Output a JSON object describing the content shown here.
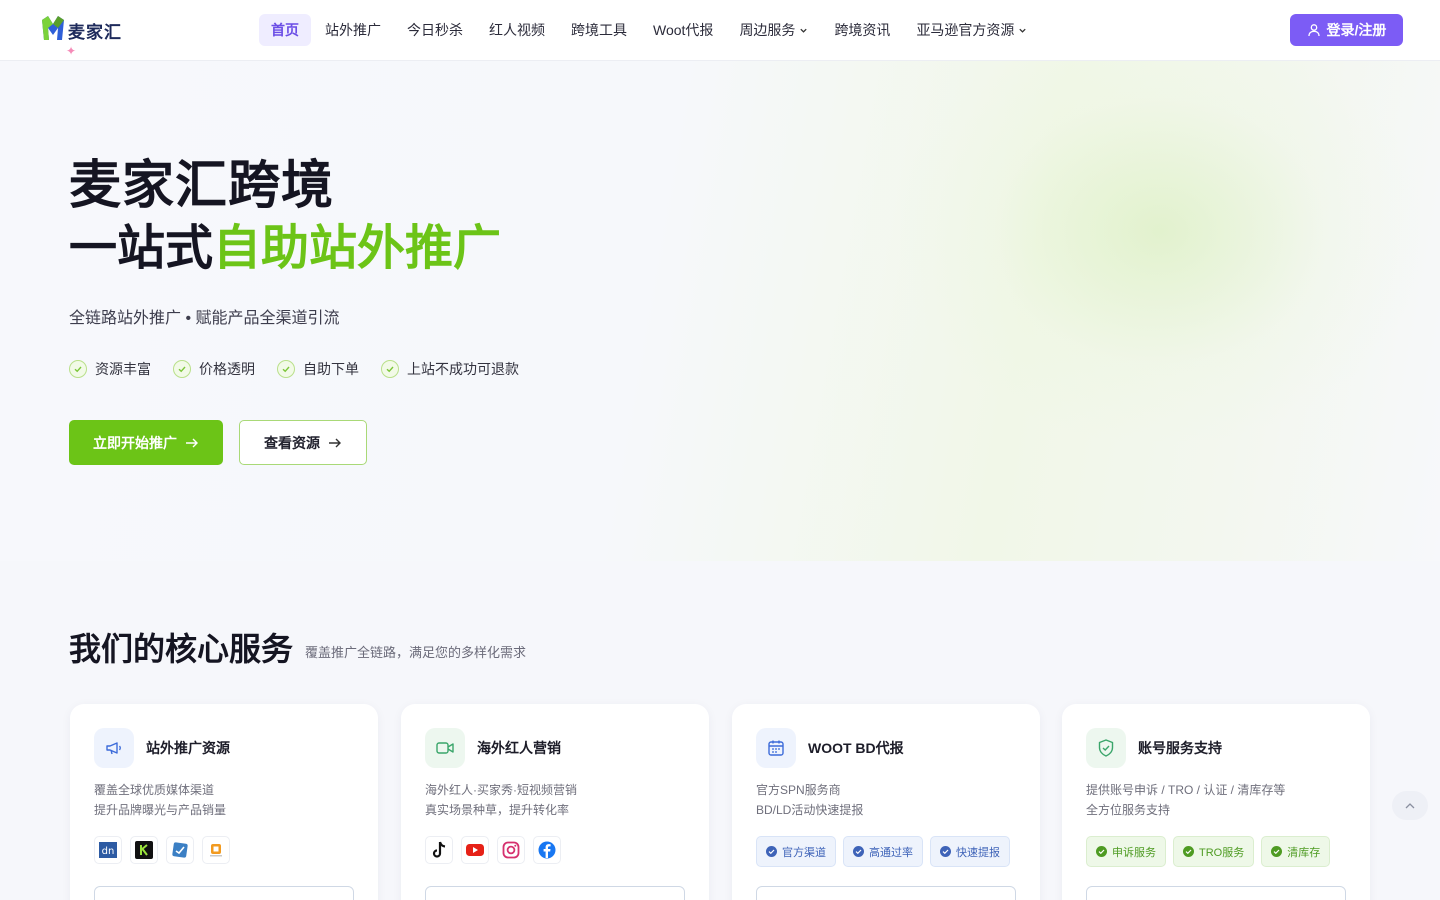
{
  "brand": {
    "name": "麦家汇"
  },
  "nav": {
    "items": [
      {
        "label": "首页",
        "active": true,
        "dropdown": false
      },
      {
        "label": "站外推广",
        "dropdown": false
      },
      {
        "label": "今日秒杀",
        "dropdown": false
      },
      {
        "label": "红人视频",
        "dropdown": false
      },
      {
        "label": "跨境工具",
        "dropdown": false
      },
      {
        "label": "Woot代报",
        "dropdown": false
      },
      {
        "label": "周边服务",
        "dropdown": true
      },
      {
        "label": "跨境资讯",
        "dropdown": false
      },
      {
        "label": "亚马逊官方资源",
        "dropdown": true
      }
    ],
    "login_label": "登录/注册"
  },
  "hero": {
    "title_line1": "麦家汇跨境",
    "title_line2_plain": "一站式",
    "title_line2_highlight": "自助站外推广",
    "subtitle": "全链路站外推广 • 赋能产品全渠道引流",
    "features": [
      "资源丰富",
      "价格透明",
      "自助下单",
      "上站不成功可退款"
    ],
    "primary_cta": "立即开始推广",
    "secondary_cta": "查看资源"
  },
  "services": {
    "title": "我们的核心服务",
    "subtitle": "覆盖推广全链路，满足您的多样化需求",
    "cards": [
      {
        "title": "站外推广资源",
        "icon": "megaphone-icon",
        "desc_line1": "覆盖全球优质媒体渠道",
        "desc_line2": "提升品牌曝光与产品销量",
        "logos": [
          "dealnews-logo",
          "kinja-logo",
          "slickdeals-logo",
          "deal-site-logo"
        ]
      },
      {
        "title": "海外红人营销",
        "icon": "video-icon",
        "desc_line1": "海外红人·买家秀·短视频营销",
        "desc_line2": "真实场景种草，提升转化率",
        "logos": [
          "tiktok-icon",
          "youtube-icon",
          "instagram-icon",
          "facebook-icon"
        ]
      },
      {
        "title": "WOOT BD代报",
        "icon": "calendar-icon",
        "desc_line1": "官方SPN服务商",
        "desc_line2": "BD/LD活动快速提报",
        "tags": [
          "官方渠道",
          "高通过率",
          "快速提报"
        ]
      },
      {
        "title": "账号服务支持",
        "icon": "shield-check-icon",
        "desc_line1": "提供账号申诉 / TRO / 认证 / 清库存等",
        "desc_line2": "全方位服务支持",
        "tags": [
          "申诉服务",
          "TRO服务",
          "清库存"
        ]
      }
    ]
  },
  "colors": {
    "accent_purple": "#7c5cf5",
    "accent_green": "#6cc417",
    "tag_blue": "#3e63b8",
    "tag_green": "#4e9b22"
  }
}
